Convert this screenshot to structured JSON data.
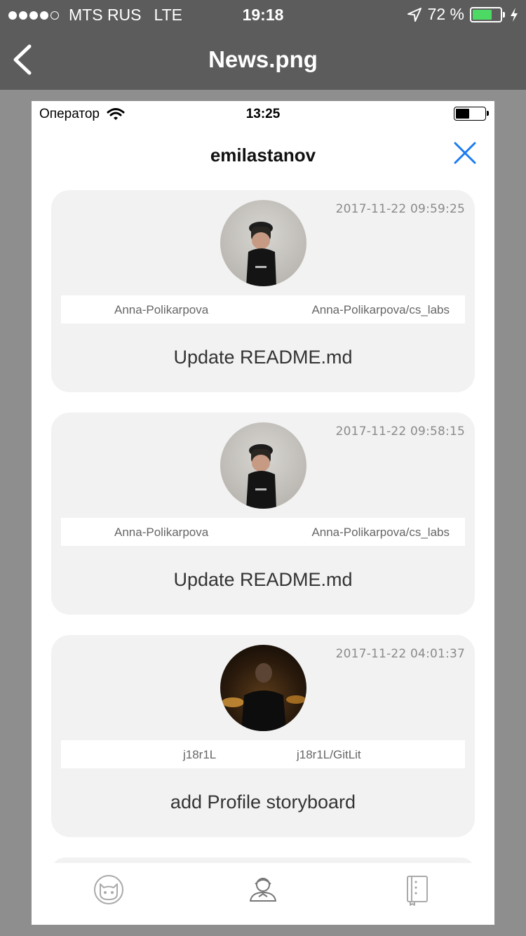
{
  "outer_status": {
    "carrier": "MTS RUS",
    "network": "LTE",
    "time": "19:18",
    "battery_pct": "72 %",
    "battery_color": "#4cd964"
  },
  "outer_nav": {
    "title": "News.png",
    "back_icon": "chevron-left-icon"
  },
  "inner_status": {
    "carrier": "Оператор",
    "time": "13:25"
  },
  "inner_header": {
    "username": "emilastanov",
    "close_icon": "close-icon",
    "accent": "#1a7bf2"
  },
  "cards": [
    {
      "timestamp": "2017-11-22 09:59:25",
      "author": "Anna-Polikarpova",
      "repo": "Anna-Polikarpova/cs_labs",
      "message": "Update README.md"
    },
    {
      "timestamp": "2017-11-22 09:58:15",
      "author": "Anna-Polikarpova",
      "repo": "Anna-Polikarpova/cs_labs",
      "message": "Update README.md"
    },
    {
      "timestamp": "2017-11-22 04:01:37",
      "author": "j18r1L",
      "repo": "j18r1L/GitLit",
      "message": "add Profile storyboard"
    }
  ],
  "tabbar": {
    "items": [
      {
        "icon": "octocat-icon"
      },
      {
        "icon": "people-icon"
      },
      {
        "icon": "repository-book-icon"
      }
    ]
  }
}
